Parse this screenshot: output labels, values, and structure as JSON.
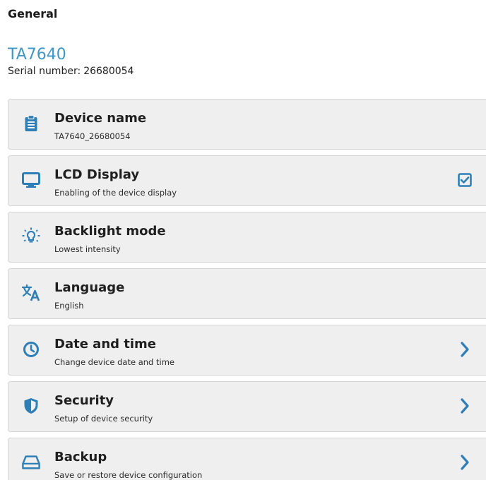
{
  "header": {
    "title": "General"
  },
  "device": {
    "model": "TA7640",
    "serial_label": "Serial number:",
    "serial_value": "26680054"
  },
  "settings": {
    "items": [
      {
        "title": "Device name",
        "subtitle": "TA7640_26680054",
        "icon": "clipboard-icon"
      },
      {
        "title": "LCD Display",
        "subtitle": "Enabling of the device display",
        "icon": "monitor-icon",
        "checked": true
      },
      {
        "title": "Backlight mode",
        "subtitle": "Lowest intensity",
        "icon": "lightbulb-icon"
      },
      {
        "title": "Language",
        "subtitle": "English",
        "icon": "translate-icon"
      },
      {
        "title": "Date and time",
        "subtitle": "Change device date and time",
        "icon": "clock-icon"
      },
      {
        "title": "Security",
        "subtitle": "Setup of device security",
        "icon": "shield-icon"
      },
      {
        "title": "Backup",
        "subtitle": "Save or restore device configuration",
        "icon": "drive-icon"
      }
    ]
  },
  "colors": {
    "accent": "#3d98c9",
    "icon": "#2e7fb8",
    "item_bg": "#efefef",
    "item_border": "#d6d6d6"
  }
}
